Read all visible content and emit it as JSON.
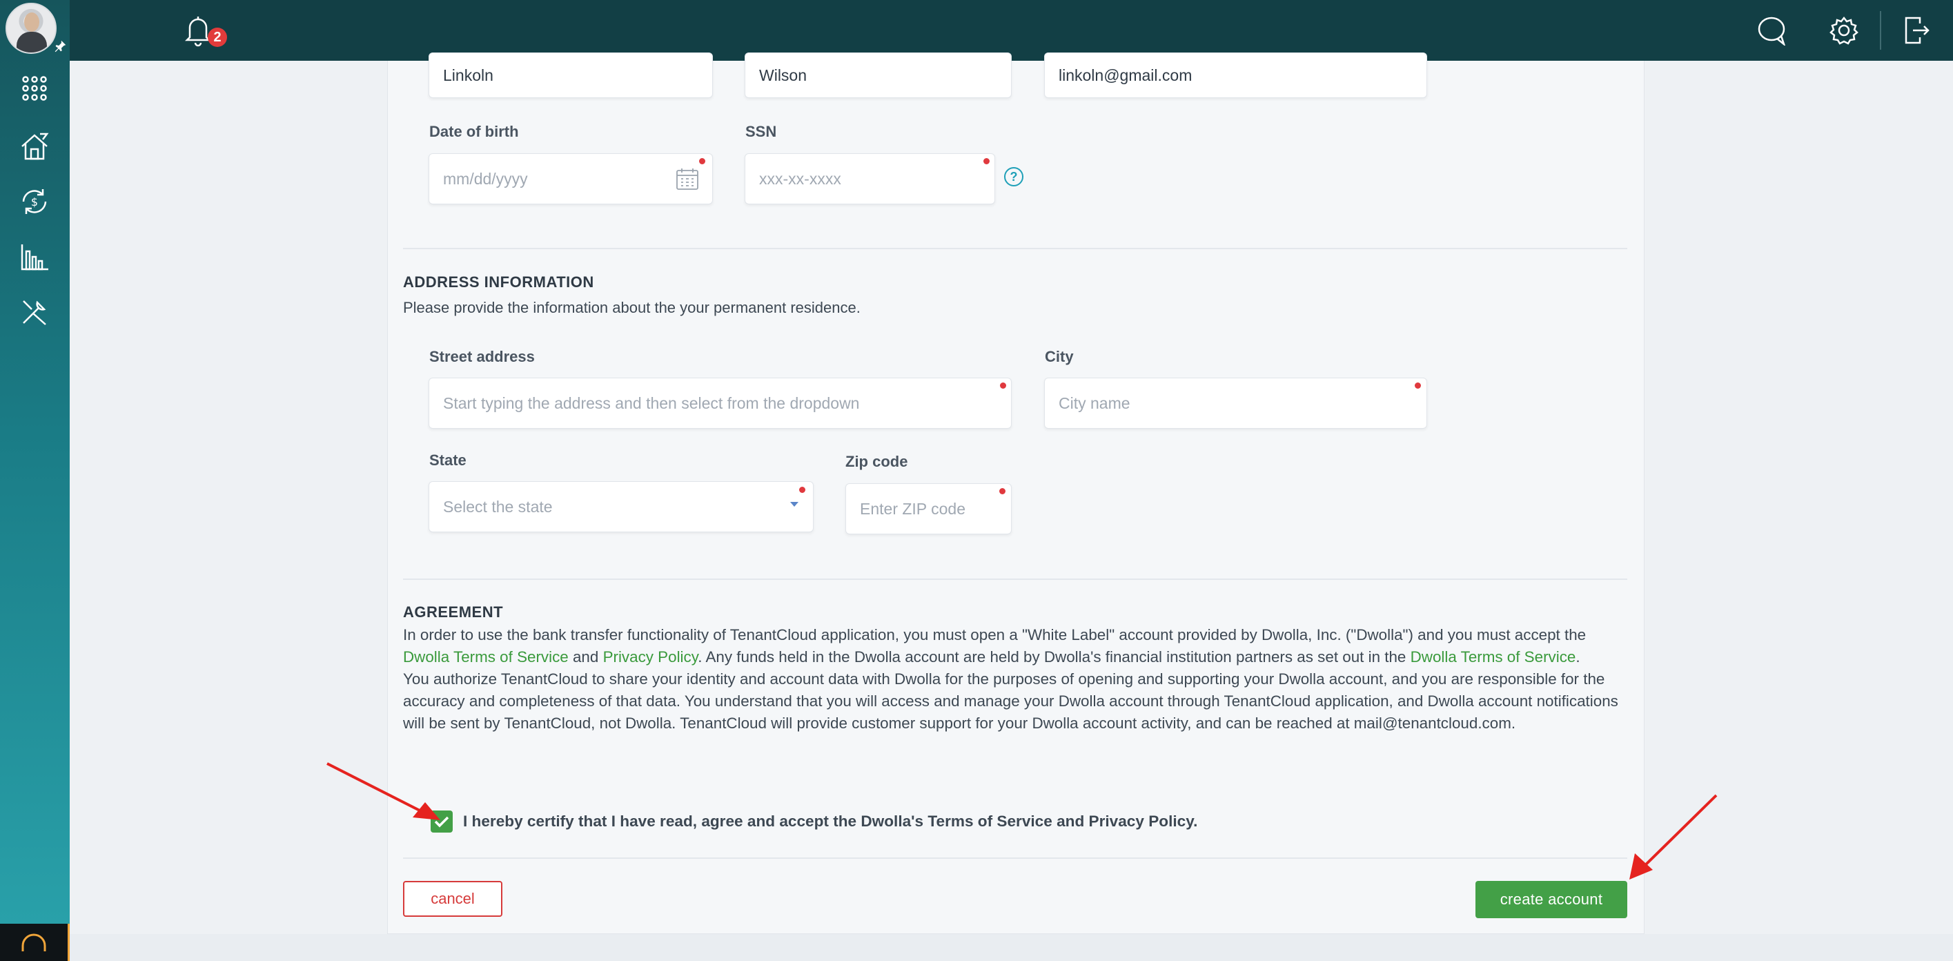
{
  "notifications": {
    "count": "2"
  },
  "personal": {
    "first_name": "Linkoln",
    "last_name": "Wilson",
    "email": "linkoln@gmail.com",
    "dob_label": "Date of birth",
    "dob_placeholder": "mm/dd/yyyy",
    "ssn_label": "SSN",
    "ssn_placeholder": "xxx-xx-xxxx",
    "help_symbol": "?"
  },
  "address": {
    "title": "ADDRESS INFORMATION",
    "subtitle": "Please provide the information about the your permanent residence.",
    "street_label": "Street address",
    "street_placeholder": "Start typing the address and then select from the dropdown",
    "city_label": "City",
    "city_placeholder": "City name",
    "state_label": "State",
    "state_placeholder": "Select the state",
    "zip_label": "Zip code",
    "zip_placeholder": "Enter ZIP code"
  },
  "agreement": {
    "title": "AGREEMENT",
    "p1_a": "In order to use the bank transfer functionality of TenantCloud application, you must open a \"White Label\" account provided by Dwolla, Inc. (\"Dwolla\") and you must accept the ",
    "link_tos": "Dwolla Terms of Service",
    "and": " and ",
    "link_privacy": "Privacy Policy",
    "p1_b": ". Any funds held in the Dwolla account are held by Dwolla's financial institution partners as set out in the ",
    "link_tos2": "Dwolla Terms of Service",
    "p1_end": ".",
    "p2": "You authorize TenantCloud to share your identity and account data with Dwolla for the purposes of opening and supporting your Dwolla account, and you are responsible for the accuracy and completeness of that data. You understand that you will access and manage your Dwolla account through TenantCloud application, and Dwolla account notifications will be sent by TenantCloud, not Dwolla. TenantCloud will provide customer support for your Dwolla account activity, and can be reached at mail@tenantcloud.com.",
    "certify": "I hereby certify that I have read, agree and accept the Dwolla's Terms of Service and Privacy Policy.",
    "checked": true
  },
  "actions": {
    "cancel": "cancel",
    "create": "create account"
  },
  "colors": {
    "accent": "#43a047",
    "danger": "#d63b3b",
    "topbar": "#123f45"
  }
}
